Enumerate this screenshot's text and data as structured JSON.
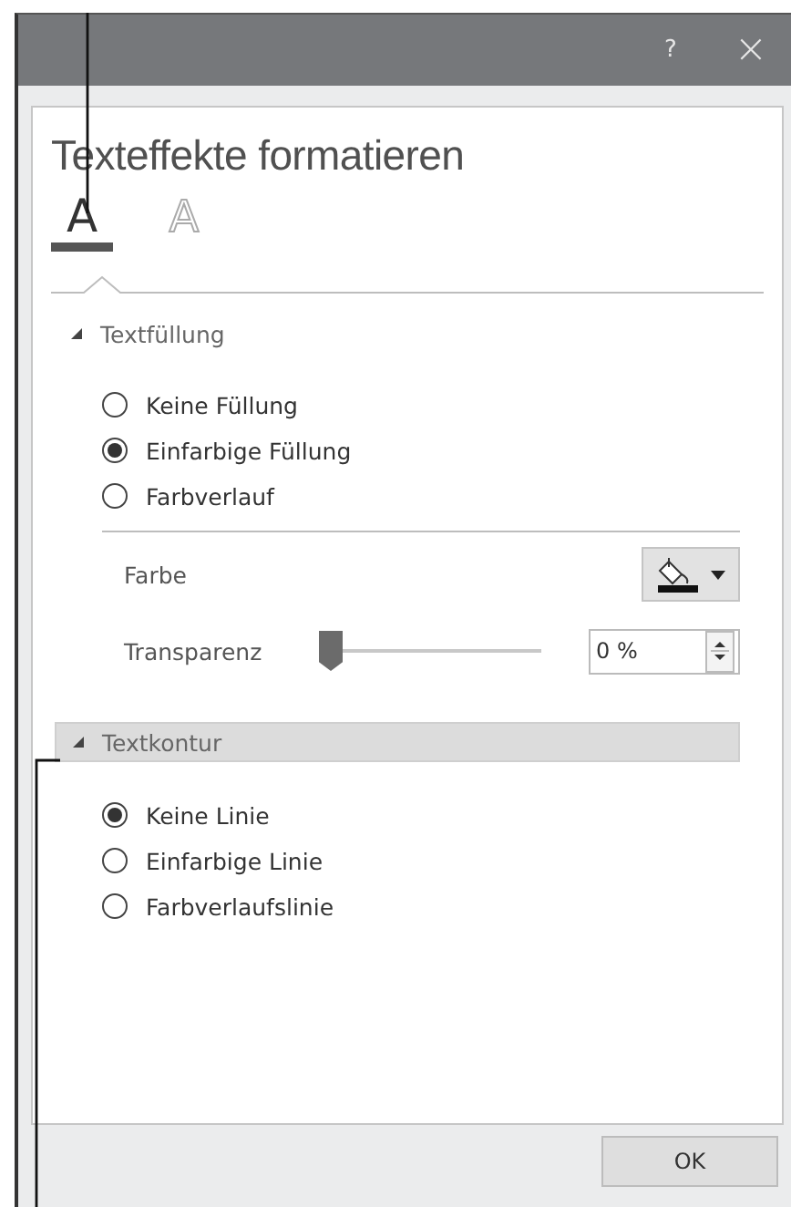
{
  "window": {
    "title_buttons": [
      {
        "kind": "help",
        "label": "?"
      },
      {
        "kind": "close",
        "label": "×"
      }
    ]
  },
  "panel": {
    "title": "Texteffekte formatieren",
    "tabs": [
      {
        "kind": "fill",
        "label": "A",
        "selected": true
      },
      {
        "kind": "outline",
        "label": "A",
        "selected": false
      }
    ],
    "sections": [
      {
        "title": "Textfüllung",
        "expanded": true,
        "highlighted": false,
        "options": [
          {
            "label": "Keine Füllung",
            "selected": false
          },
          {
            "label": "Einfarbige Füllung",
            "selected": true
          },
          {
            "label": "Farbverlauf",
            "selected": false
          }
        ],
        "settings": [
          {
            "kind": "color",
            "label": "Farbe"
          },
          {
            "kind": "slider",
            "label": "Transparenz",
            "level": 0,
            "value": "0 %"
          }
        ]
      },
      {
        "title": "Textkontur",
        "expanded": true,
        "highlighted": true,
        "options": [
          {
            "label": "Keine Linie",
            "selected": true
          },
          {
            "label": "Einfarbige Linie",
            "selected": false
          },
          {
            "label": "Farbverlaufslinie",
            "selected": false
          }
        ]
      }
    ]
  },
  "buttons": [
    "OK"
  ]
}
